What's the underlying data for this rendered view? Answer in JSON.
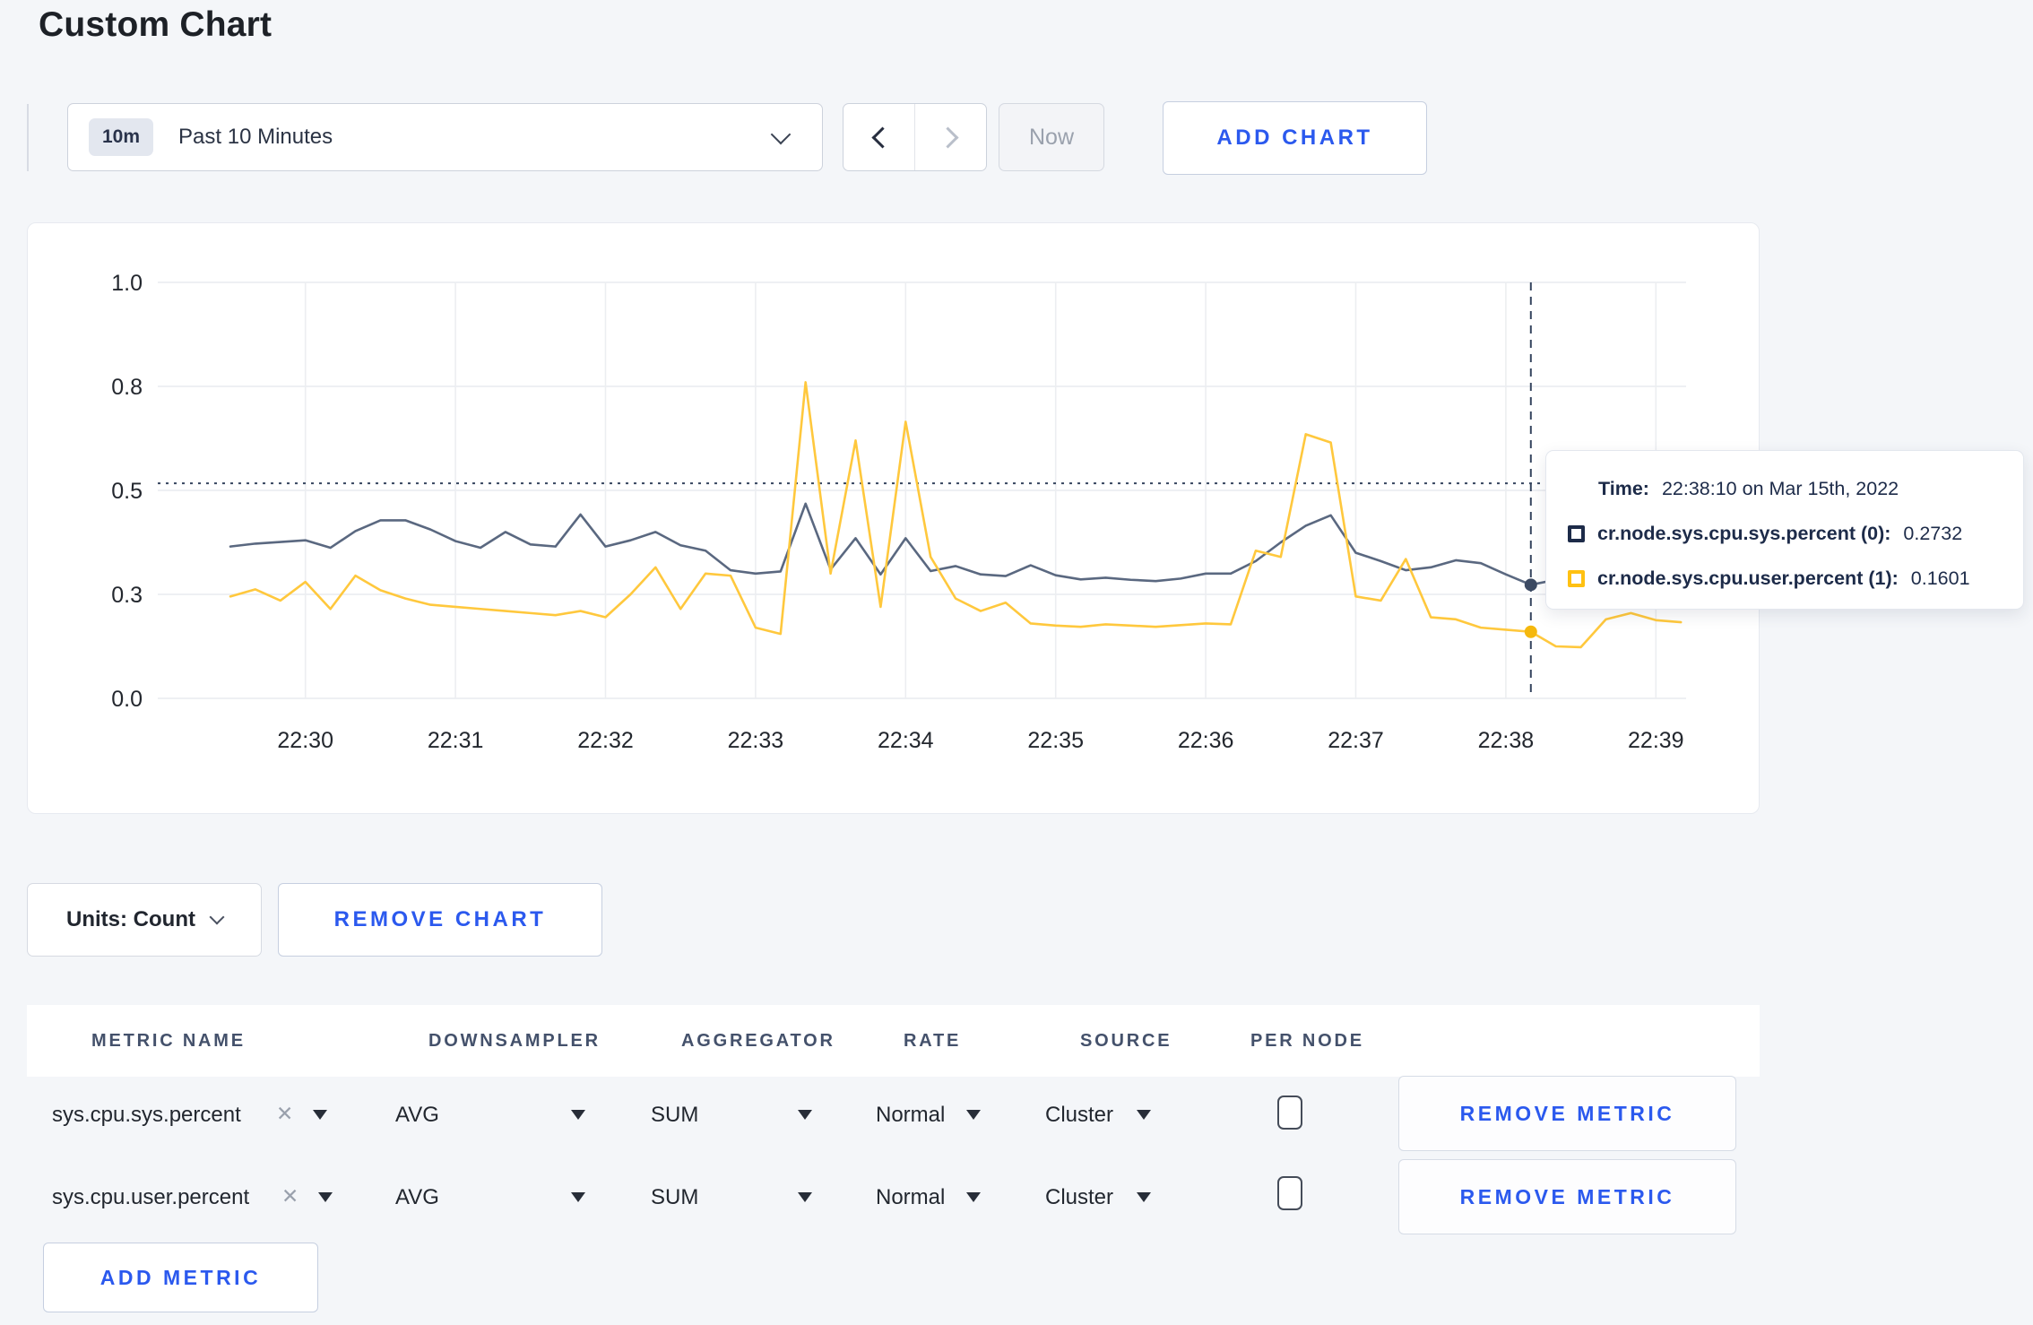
{
  "title": "Custom Chart",
  "toolbar": {
    "time_range_badge": "10m",
    "time_range_label": "Past 10 Minutes",
    "now_label": "Now",
    "add_chart_label": "ADD CHART"
  },
  "chart_data": {
    "type": "line",
    "x_start": "22:29:30",
    "x_step_seconds": 10,
    "x_ticks": [
      {
        "index": 3,
        "label": "22:30"
      },
      {
        "index": 9,
        "label": "22:31"
      },
      {
        "index": 15,
        "label": "22:32"
      },
      {
        "index": 21,
        "label": "22:33"
      },
      {
        "index": 27,
        "label": "22:34"
      },
      {
        "index": 33,
        "label": "22:35"
      },
      {
        "index": 39,
        "label": "22:36"
      },
      {
        "index": 45,
        "label": "22:37"
      },
      {
        "index": 51,
        "label": "22:38"
      },
      {
        "index": 57,
        "label": "22:39"
      }
    ],
    "y_ticks": [
      {
        "label": "0.0",
        "value": 0
      },
      {
        "label": "0.3",
        "value": 0.25
      },
      {
        "label": "0.5",
        "value": 0.5
      },
      {
        "label": "0.8",
        "value": 0.75
      },
      {
        "label": "1.0",
        "value": 1
      }
    ],
    "ylim": [
      0,
      1
    ],
    "grid": true,
    "threshold_value": 0.517,
    "crosshair_index": 52,
    "crosshair_time": "22:38:10",
    "legend_position": "tooltip",
    "series": [
      {
        "name": "cr.node.sys.cpu.sys.percent (0)",
        "color": "#5a6880",
        "dot_color": "#3c4a63",
        "values": [
          0.365,
          0.372,
          0.376,
          0.38,
          0.362,
          0.402,
          0.428,
          0.428,
          0.406,
          0.378,
          0.362,
          0.4,
          0.37,
          0.365,
          0.442,
          0.365,
          0.38,
          0.4,
          0.368,
          0.355,
          0.308,
          0.3,
          0.305,
          0.468,
          0.31,
          0.385,
          0.298,
          0.385,
          0.306,
          0.318,
          0.298,
          0.294,
          0.32,
          0.296,
          0.286,
          0.29,
          0.285,
          0.282,
          0.288,
          0.3,
          0.3,
          0.33,
          0.375,
          0.415,
          0.44,
          0.35,
          0.33,
          0.308,
          0.315,
          0.332,
          0.325,
          0.298,
          0.273,
          0.285,
          0.28,
          0.285,
          0.295,
          0.29,
          0.295
        ]
      },
      {
        "name": "cr.node.sys.cpu.user.percent (1)",
        "color": "#ffc83d",
        "dot_color": "#f5b80d",
        "values": [
          0.245,
          0.262,
          0.235,
          0.28,
          0.215,
          0.295,
          0.26,
          0.24,
          0.225,
          0.22,
          0.215,
          0.21,
          0.205,
          0.2,
          0.21,
          0.195,
          0.25,
          0.315,
          0.215,
          0.3,
          0.295,
          0.17,
          0.155,
          0.76,
          0.3,
          0.62,
          0.22,
          0.665,
          0.34,
          0.24,
          0.21,
          0.23,
          0.18,
          0.175,
          0.172,
          0.178,
          0.175,
          0.172,
          0.176,
          0.18,
          0.178,
          0.355,
          0.34,
          0.635,
          0.615,
          0.245,
          0.235,
          0.335,
          0.195,
          0.19,
          0.17,
          0.165,
          0.16,
          0.125,
          0.123,
          0.19,
          0.205,
          0.188,
          0.183
        ]
      }
    ]
  },
  "tooltip": {
    "time_label": "Time:",
    "time_value": "22:38:10 on Mar 15th, 2022",
    "rows": [
      {
        "label": "cr.node.sys.cpu.sys.percent (0):",
        "value": "0.2732",
        "color": "#1d2b49"
      },
      {
        "label": "cr.node.sys.cpu.user.percent (1):",
        "value": "0.1601",
        "color": "#ffc112"
      }
    ]
  },
  "chart_controls": {
    "units_label": "Units: Count",
    "remove_chart_label": "REMOVE CHART"
  },
  "metrics_table": {
    "columns": [
      "METRIC NAME",
      "DOWNSAMPLER",
      "AGGREGATOR",
      "RATE",
      "SOURCE",
      "PER NODE"
    ],
    "remove_metric_label": "REMOVE METRIC",
    "add_metric_label": "ADD METRIC",
    "rows": [
      {
        "metric": "sys.cpu.sys.percent",
        "downsampler": "AVG",
        "aggregator": "SUM",
        "rate": "Normal",
        "source": "Cluster",
        "per_node_checked": false
      },
      {
        "metric": "sys.cpu.user.percent",
        "downsampler": "AVG",
        "aggregator": "SUM",
        "rate": "Normal",
        "source": "Cluster",
        "per_node_checked": false
      }
    ]
  }
}
